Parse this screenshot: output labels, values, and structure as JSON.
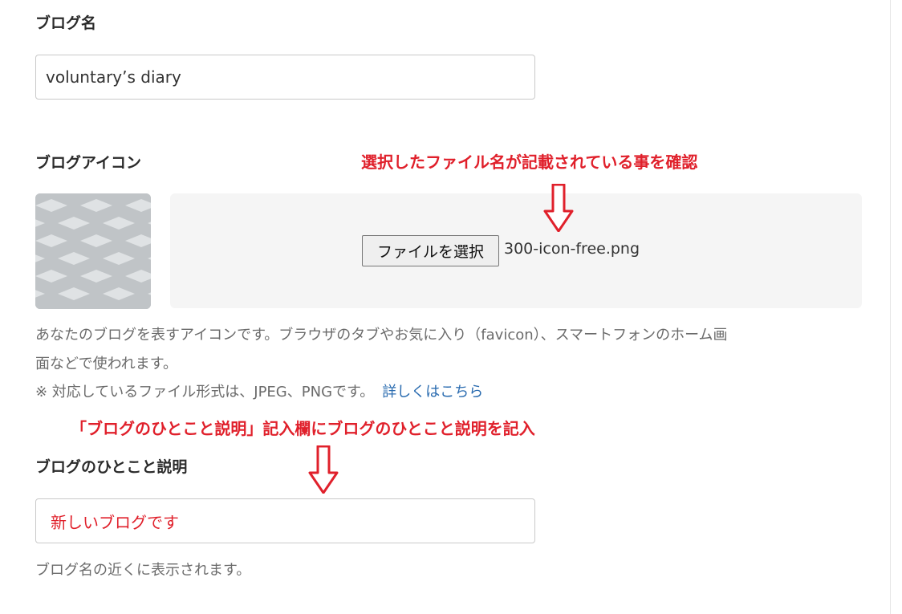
{
  "blog_name": {
    "label": "ブログ名",
    "value": "voluntary’s diary"
  },
  "blog_icon": {
    "label": "ブログアイコン",
    "file_button_label": "ファイルを選択",
    "file_name": "300-icon-free.png",
    "help_line1": "あなたのブログを表すアイコンです。ブラウザのタブやお気に入り（favicon）、スマートフォンのホーム画",
    "help_line2": "面などで使われます。",
    "formats_note": "※ 対応しているファイル形式は、JPEG、PNGです。",
    "details_link": "詳しくはこちら"
  },
  "blog_description": {
    "label": "ブログのひとこと説明",
    "value": "新しいブログです",
    "help": "ブログ名の近くに表示されます。"
  },
  "annotations": {
    "file_check": "選択したファイル名が記載されている事を確認",
    "description_note": "「ブログのひとこと説明」記入欄にブログのひとこと説明を記入"
  },
  "colors": {
    "annotation_red": "#e0202b",
    "link_blue": "#2b6cb0",
    "thumb_gray": "#c0c4c7"
  }
}
